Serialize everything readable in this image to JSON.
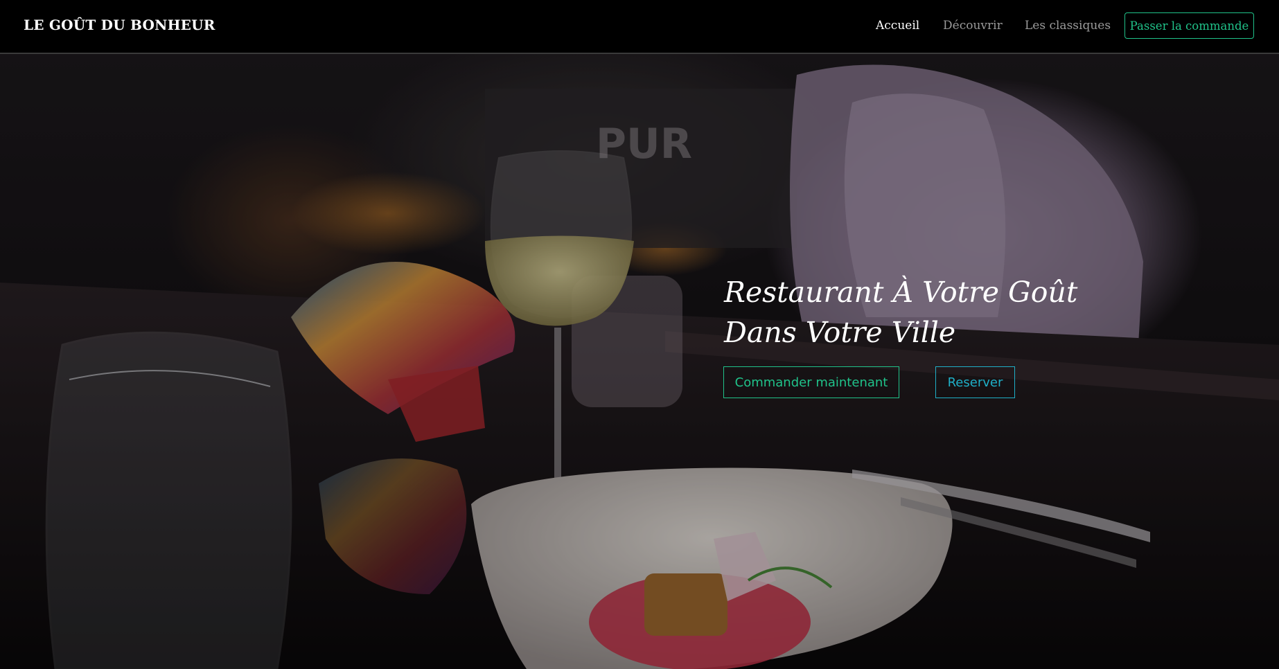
{
  "brand": "LE GOÛT DU BONHEUR",
  "nav": {
    "links": [
      {
        "label": "Accueil",
        "active": true
      },
      {
        "label": "Découvrir",
        "active": false
      },
      {
        "label": "Les classiques",
        "active": false
      }
    ],
    "cta_label": "Passer la commande"
  },
  "hero": {
    "title_line1": "Restaurant À Votre Goût",
    "title_line2": "Dans Votre Ville",
    "order_label": "Commander maintenant",
    "reserve_label": "Reserver",
    "image_sign_text": "PUR"
  },
  "colors": {
    "accent_green": "#20c38a",
    "accent_cyan": "#1fb0c8",
    "navbar_bg": "#000000"
  }
}
